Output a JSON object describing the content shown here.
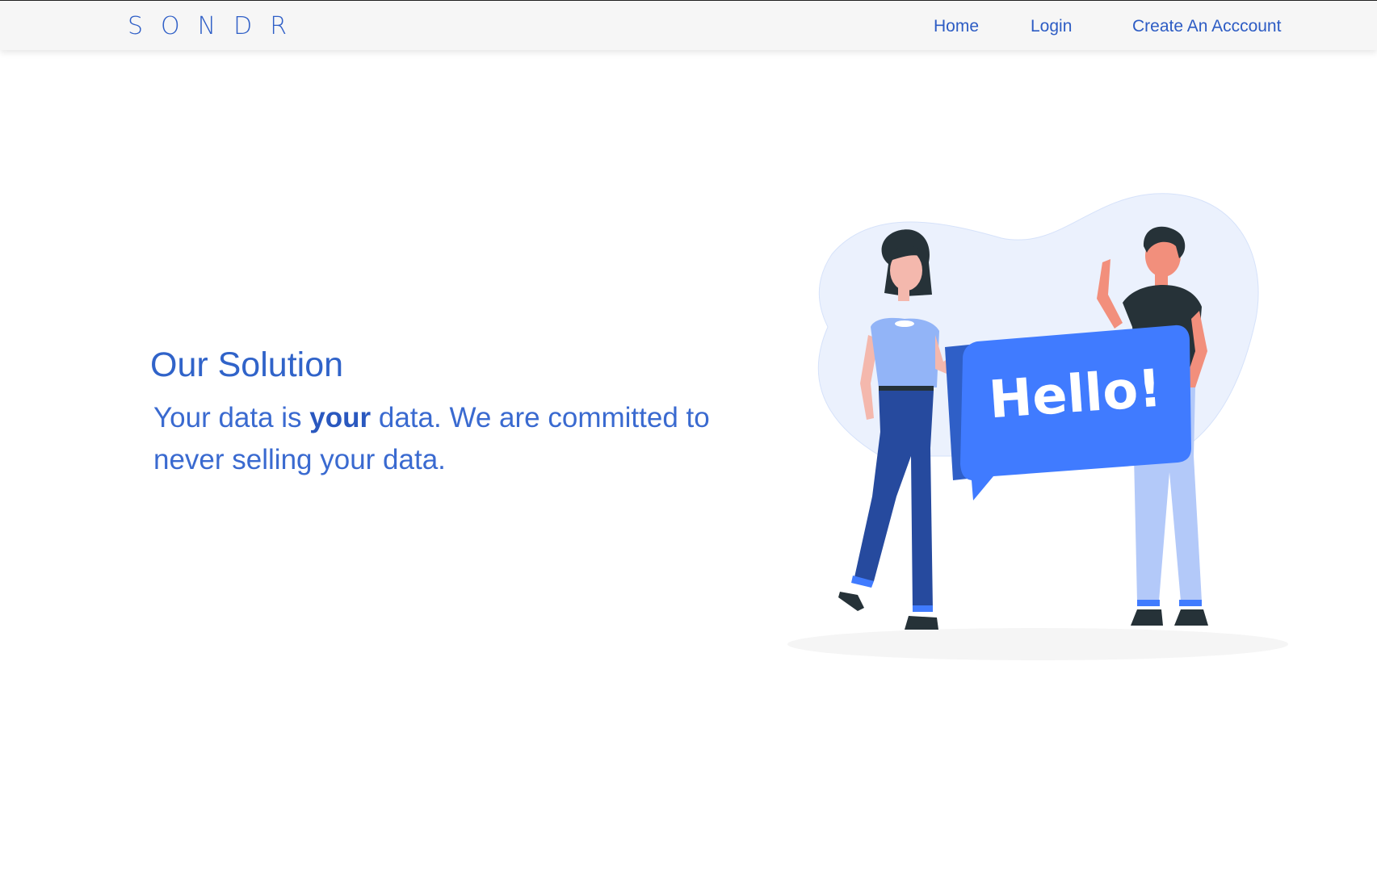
{
  "header": {
    "logo": "SONDR",
    "nav": {
      "home": "Home",
      "login": "Login",
      "create_account": "Create An Acccount"
    }
  },
  "main": {
    "title": "Our Solution",
    "text_part1": "Your data is ",
    "text_bold": "your",
    "text_part2": " data. We are committed to never selling your data."
  },
  "illustration": {
    "speech_bubble_text": "Hello!"
  },
  "colors": {
    "accent": "#2f5fc7",
    "bubble": "#407bff",
    "blob": "#ebf1fd"
  }
}
